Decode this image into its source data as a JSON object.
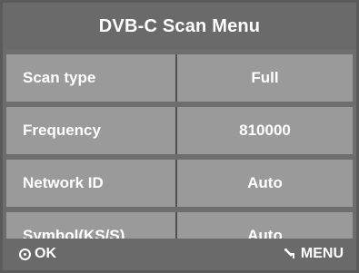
{
  "title": "DVB-C Scan Menu",
  "rows": [
    {
      "label": "Scan type",
      "value": "Full"
    },
    {
      "label": "Frequency",
      "value": "810000"
    },
    {
      "label": "Network ID",
      "value": "Auto"
    },
    {
      "label": "Symbol(KS/S)",
      "value": "Auto"
    }
  ],
  "footer": {
    "ok_label": "OK",
    "menu_label": "MENU",
    "ok_icon": "ok-button-icon",
    "menu_icon": "return-arrow-icon"
  },
  "colors": {
    "frame": "#6d6d6d",
    "row_background": "#9a9a9a",
    "text": "#ffffff"
  }
}
